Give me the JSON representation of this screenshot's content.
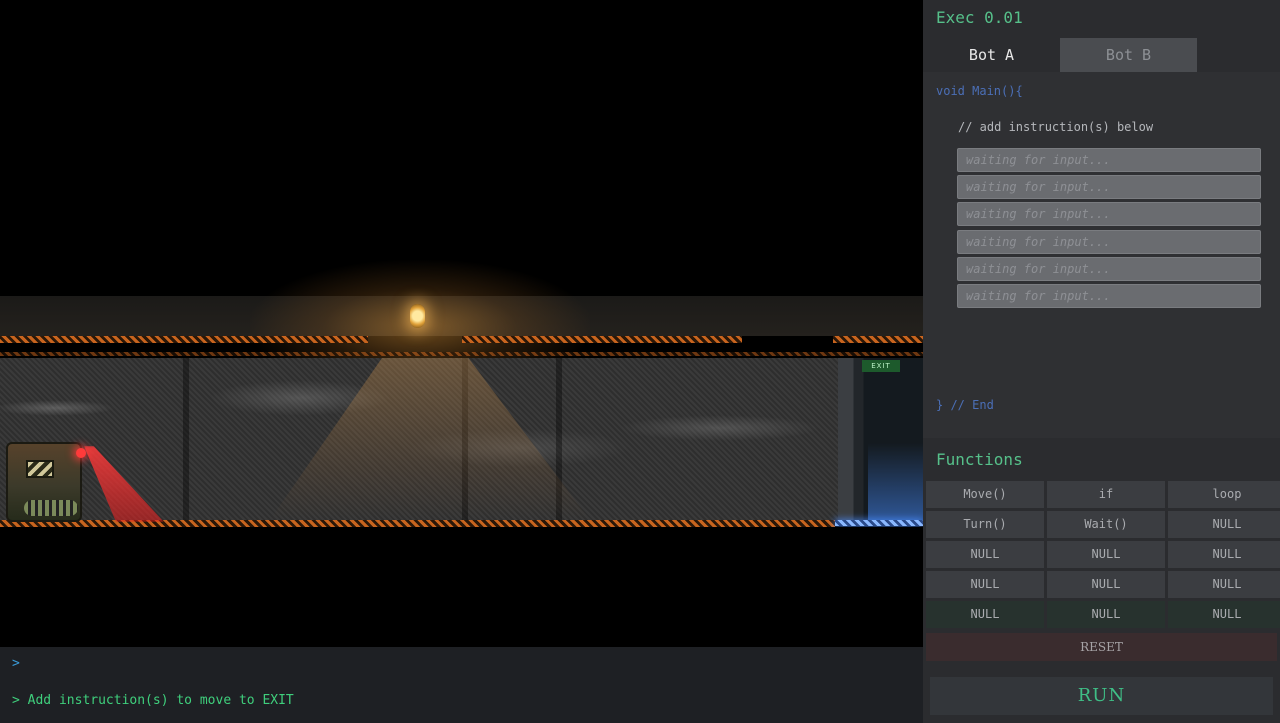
{
  "game": {
    "exit_sign": "EXIT"
  },
  "console": {
    "prompt": ">",
    "message": "> Add instruction(s) to move to EXIT"
  },
  "panel": {
    "title": "Exec 0.01",
    "tabs": [
      {
        "label": "Bot A",
        "active": true
      },
      {
        "label": "Bot B",
        "active": false
      }
    ],
    "code": {
      "header": "void Main(){",
      "comment": "// add instruction(s) below",
      "slots": [
        "waiting for input...",
        "waiting for input...",
        "waiting for input...",
        "waiting for input...",
        "waiting for input...",
        "waiting for input..."
      ],
      "footer": "} // End"
    },
    "functions_title": "Functions",
    "functions": [
      [
        "Move()",
        "if",
        "loop"
      ],
      [
        "Turn()",
        "Wait()",
        "NULL"
      ],
      [
        "NULL",
        "NULL",
        "NULL"
      ],
      [
        "NULL",
        "NULL",
        "NULL"
      ],
      [
        "NULL",
        "NULL",
        "NULL"
      ]
    ],
    "reset_label": "RESET",
    "run_label": "RUN"
  },
  "colors": {
    "accent_green": "#56c08a",
    "code_blue": "#4b6fb7",
    "console_prompt": "#3a9bd8",
    "laser_red": "#ff3a3a",
    "hazard_orange": "#c8641e"
  }
}
